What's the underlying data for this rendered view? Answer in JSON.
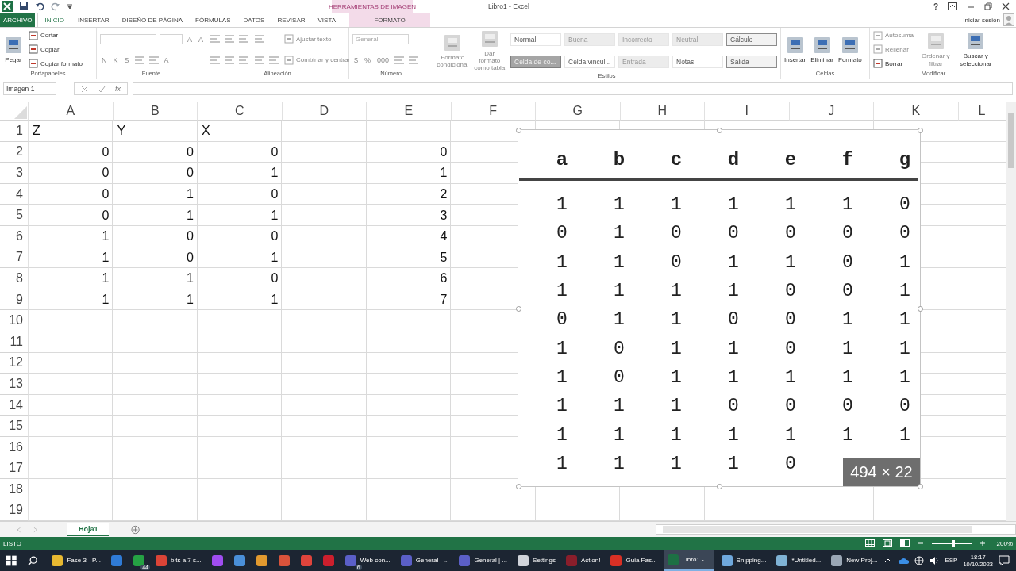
{
  "title_bar": {
    "context_header": "HERRAMIENTAS DE IMAGEN",
    "title": "Libro1 - Excel",
    "help": "?",
    "sign_in": "Iniciar sesión"
  },
  "tabs": [
    {
      "label": "ARCHIVO",
      "kind": "file",
      "selected": false
    },
    {
      "label": "INICIO",
      "kind": "tab",
      "selected": true
    },
    {
      "label": "INSERTAR",
      "kind": "tab",
      "selected": false
    },
    {
      "label": "DISEÑO DE PÁGINA",
      "kind": "tab",
      "selected": false
    },
    {
      "label": "FÓRMULAS",
      "kind": "tab",
      "selected": false
    },
    {
      "label": "DATOS",
      "kind": "tab",
      "selected": false
    },
    {
      "label": "REVISAR",
      "kind": "tab",
      "selected": false
    },
    {
      "label": "VISTA",
      "kind": "tab",
      "selected": false
    },
    {
      "label": "FORMATO",
      "kind": "context",
      "selected": false
    }
  ],
  "ribbon": {
    "groups": [
      {
        "label": "Portapapeles",
        "stacks": [
          [
            [
              {
                "kind": "large",
                "text": "Pegar",
                "disabled": false
              }
            ]
          ],
          [
            [
              {
                "kind": "small",
                "text": "Cortar",
                "disabled": false
              }
            ],
            [
              {
                "kind": "small",
                "text": "Copiar",
                "disabled": false
              }
            ],
            [
              {
                "kind": "small",
                "text": "Copiar formato",
                "disabled": false
              }
            ]
          ]
        ]
      },
      {
        "label": "Fuente",
        "stacks": [
          [
            [
              {
                "kind": "select"
              },
              {
                "kind": "select-narrow"
              },
              {
                "kind": "glyph",
                "text": "A"
              },
              {
                "kind": "glyph",
                "text": "A"
              }
            ],
            [
              {
                "kind": "glyph",
                "text": "N"
              },
              {
                "kind": "glyph",
                "text": "K"
              },
              {
                "kind": "glyph",
                "text": "S"
              },
              {
                "kind": "icon"
              },
              {
                "kind": "icon"
              },
              {
                "kind": "glyph",
                "text": "A"
              }
            ]
          ]
        ]
      },
      {
        "label": "Alineación",
        "stacks": [
          [
            [
              {
                "kind": "icon"
              },
              {
                "kind": "icon"
              },
              {
                "kind": "icon"
              }
            ],
            [
              {
                "kind": "icon"
              },
              {
                "kind": "icon"
              },
              {
                "kind": "icon"
              }
            ]
          ],
          [
            [
              {
                "kind": "icon"
              }
            ],
            [
              {
                "kind": "icon"
              },
              {
                "kind": "icon"
              }
            ]
          ],
          [
            [
              {
                "kind": "small",
                "text": "Ajustar texto",
                "disabled": true
              }
            ],
            [
              {
                "kind": "small",
                "text": "Combinar y centrar",
                "disabled": true
              }
            ]
          ]
        ]
      },
      {
        "label": "Número",
        "stacks": [
          [
            [
              {
                "kind": "select",
                "value": "General"
              }
            ],
            [
              {
                "kind": "glyph",
                "text": "$"
              },
              {
                "kind": "glyph",
                "text": "%"
              },
              {
                "kind": "glyph",
                "text": "000"
              },
              {
                "kind": "icon"
              },
              {
                "kind": "icon"
              }
            ]
          ]
        ]
      },
      {
        "label": "Estilos",
        "stacks": [
          [
            [
              {
                "kind": "large",
                "text": "Formato condicional",
                "disabled": true
              }
            ]
          ],
          [
            [
              {
                "kind": "large",
                "text": "Dar formato como tabla",
                "disabled": true
              }
            ]
          ],
          [
            [
              {
                "kind": "style",
                "text": "Normal"
              },
              {
                "kind": "style-shaded",
                "text": "Buena"
              },
              {
                "kind": "style-shaded",
                "text": "Incorrecto"
              },
              {
                "kind": "style-shaded",
                "text": "Neutral"
              },
              {
                "kind": "style-boxed",
                "text": "Cálculo"
              }
            ],
            [
              {
                "kind": "style-dark",
                "text": "Celda de co..."
              },
              {
                "kind": "style",
                "text": "Celda vincul..."
              },
              {
                "kind": "style-shaded",
                "text": "Entrada"
              },
              {
                "kind": "style",
                "text": "Notas"
              },
              {
                "kind": "style-boxed",
                "text": "Salida"
              }
            ]
          ]
        ]
      },
      {
        "label": "Celdas",
        "stacks": [
          [
            [
              {
                "kind": "large",
                "text": "Insertar",
                "disabled": false
              }
            ]
          ],
          [
            [
              {
                "kind": "large",
                "text": "Eliminar",
                "disabled": false
              }
            ]
          ],
          [
            [
              {
                "kind": "large",
                "text": "Formato",
                "disabled": false
              }
            ]
          ]
        ]
      },
      {
        "label": "Modificar",
        "stacks": [
          [
            [
              {
                "kind": "small",
                "text": "Autosuma",
                "disabled": true
              }
            ],
            [
              {
                "kind": "small",
                "text": "Rellenar",
                "disabled": true
              }
            ],
            [
              {
                "kind": "small",
                "text": "Borrar",
                "disabled": false
              }
            ]
          ],
          [
            [
              {
                "kind": "large",
                "text": "Ordenar y filtrar",
                "disabled": true
              }
            ]
          ],
          [
            [
              {
                "kind": "large",
                "text": "Buscar y seleccionar",
                "disabled": false
              }
            ]
          ]
        ]
      }
    ]
  },
  "formula_bar": {
    "name_box": "Imagen 1",
    "function_label": "fx"
  },
  "sheet": {
    "columns": [
      "A",
      "B",
      "C",
      "D",
      "E",
      "F",
      "G",
      "H",
      "I",
      "J",
      "K",
      "L"
    ],
    "rows": [
      {
        "number": "1",
        "kind": "text",
        "col_a": "Z",
        "col_b": "Y",
        "col_c": "X"
      },
      {
        "number": "2",
        "kind": "number",
        "col_a": "0",
        "col_b": "0",
        "col_c": "0",
        "col_e": "0"
      },
      {
        "number": "3",
        "kind": "number",
        "col_a": "0",
        "col_b": "0",
        "col_c": "1",
        "col_e": "1"
      },
      {
        "number": "4",
        "kind": "number",
        "col_a": "0",
        "col_b": "1",
        "col_c": "0",
        "col_e": "2"
      },
      {
        "number": "5",
        "kind": "number",
        "col_a": "0",
        "col_b": "1",
        "col_c": "1",
        "col_e": "3"
      },
      {
        "number": "6",
        "kind": "number",
        "col_a": "1",
        "col_b": "0",
        "col_c": "0",
        "col_e": "4"
      },
      {
        "number": "7",
        "kind": "number",
        "col_a": "1",
        "col_b": "0",
        "col_c": "1",
        "col_e": "5"
      },
      {
        "number": "8",
        "kind": "number",
        "col_a": "1",
        "col_b": "1",
        "col_c": "0",
        "col_e": "6"
      },
      {
        "number": "9",
        "kind": "number",
        "col_a": "1",
        "col_b": "1",
        "col_c": "1",
        "col_e": "7"
      },
      {
        "number": "10"
      },
      {
        "number": "11"
      },
      {
        "number": "12"
      },
      {
        "number": "13"
      },
      {
        "number": "14"
      },
      {
        "number": "15"
      },
      {
        "number": "16"
      },
      {
        "number": "17"
      },
      {
        "number": "18"
      },
      {
        "number": "19"
      }
    ]
  },
  "image": {
    "headers": [
      "a",
      "b",
      "c",
      "d",
      "e",
      "f",
      "g"
    ],
    "rows": [
      [
        "1",
        "1",
        "1",
        "1",
        "1",
        "1",
        "0"
      ],
      [
        "0",
        "1",
        "0",
        "0",
        "0",
        "0",
        "0"
      ],
      [
        "1",
        "1",
        "0",
        "1",
        "1",
        "0",
        "1"
      ],
      [
        "1",
        "1",
        "1",
        "1",
        "0",
        "0",
        "1"
      ],
      [
        "0",
        "1",
        "1",
        "0",
        "0",
        "1",
        "1"
      ],
      [
        "1",
        "0",
        "1",
        "1",
        "0",
        "1",
        "1"
      ],
      [
        "1",
        "0",
        "1",
        "1",
        "1",
        "1",
        "1"
      ],
      [
        "1",
        "1",
        "1",
        "0",
        "0",
        "0",
        "0"
      ],
      [
        "1",
        "1",
        "1",
        "1",
        "1",
        "1",
        "1"
      ],
      [
        "1",
        "1",
        "1",
        "1",
        "0"
      ]
    ],
    "size_badge": "494 × 22"
  },
  "sheet_tabs": [
    {
      "label": "Hoja1",
      "selected": true
    }
  ],
  "status_bar": {
    "status": "LISTO",
    "zoom": "200%",
    "zoom_slider": {
      "level": 0.55
    }
  },
  "taskbar": {
    "items": [
      {
        "label": "Fase 3 - P...",
        "color": "#e8b931",
        "selected": false
      },
      {
        "color": "#2f7bd6",
        "selected": false
      },
      {
        "color": "#25a244",
        "badge": "44",
        "selected": false
      },
      {
        "label": "bits a 7 s...",
        "color": "#db4437",
        "selected": false
      },
      {
        "color": "#a04df0",
        "selected": false
      },
      {
        "color": "#4a8fd8",
        "selected": false
      },
      {
        "color": "#e29a2f",
        "selected": false
      },
      {
        "color": "#d9533b",
        "selected": false
      },
      {
        "color": "#e0443c",
        "selected": false
      },
      {
        "color": "#cc1f2d",
        "selected": false
      },
      {
        "label": "Web con...",
        "color": "#5b5fc7",
        "badge": "6",
        "selected": false
      },
      {
        "label": "General | ...",
        "color": "#5b5fc7",
        "selected": false
      },
      {
        "label": "General | ...",
        "color": "#5b5fc7",
        "selected": false
      },
      {
        "label": "Settings",
        "color": "#d0d4da",
        "selected": false
      },
      {
        "label": "Action!",
        "color": "#8a1e2b",
        "selected": false
      },
      {
        "label": "Guia Fas...",
        "color": "#d93025",
        "selected": false
      },
      {
        "label": "Libro1 - ...",
        "color": "#1d7044",
        "selected": true
      },
      {
        "label": "Snipping...",
        "color": "#6fa8dc",
        "selected": false
      },
      {
        "label": "*Untitled...",
        "color": "#7fb3d5",
        "selected": false
      },
      {
        "label": "New Proj...",
        "color": "#9aa7b5",
        "selected": false
      }
    ],
    "language": "ESP",
    "time": "18:17",
    "date": "10/10/2023"
  }
}
